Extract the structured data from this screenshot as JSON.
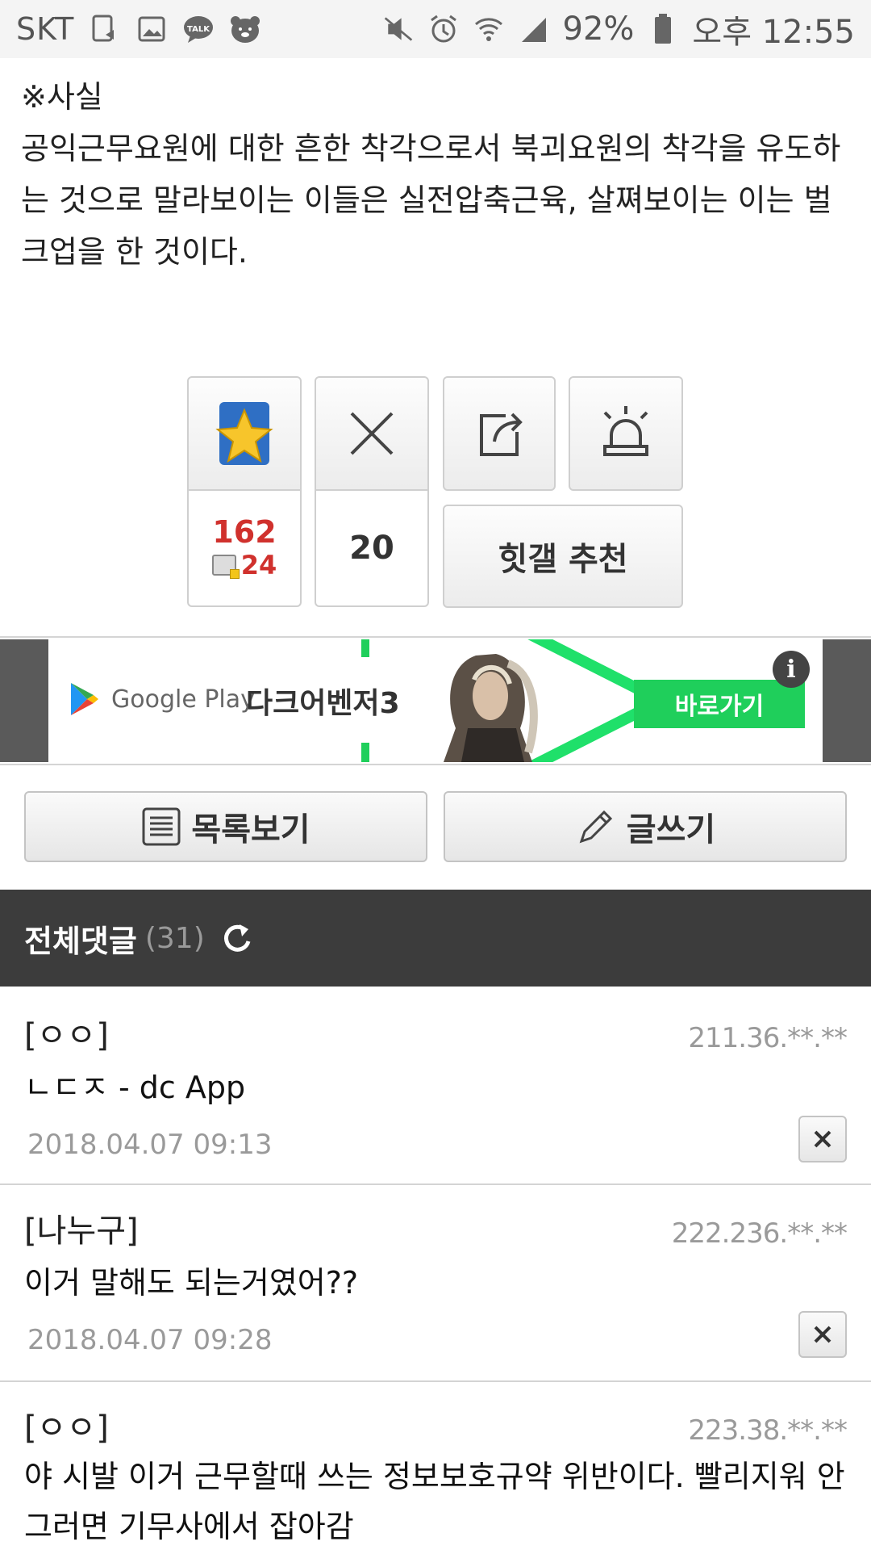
{
  "status_bar": {
    "carrier": "SKT",
    "battery": "92%",
    "time": "오후 12:55",
    "icons": [
      "screen-record-icon",
      "gallery-icon",
      "talk-icon",
      "bear-icon",
      "mute-icon",
      "alarm-icon",
      "wifi-icon",
      "signal-icon",
      "battery-icon"
    ]
  },
  "post": {
    "label": "※사실",
    "body": "공익근무요원에 대한 흔한 착각으로서 북괴요원의 착각을 유도하는 것으로 말라보이는 이들은 실전압축근육, 살쪄보이는 이는 벌크업을 한 것이다."
  },
  "reactions": {
    "recommend_count": "162",
    "fixed_recommend_count": "24",
    "not_recommend_count": "20",
    "hitgal_label": "힛갤 추천",
    "colors": {
      "count_red": "#d0312d"
    }
  },
  "ad": {
    "store": "Google Play",
    "game": "다크어벤저3",
    "cta": "바로가기",
    "info": "i",
    "colors": {
      "accent": "#1fcf5b"
    }
  },
  "actions": {
    "list_label": "목록보기",
    "write_label": "글쓰기"
  },
  "comments_header": {
    "title": "전체댓글",
    "count": "(31)"
  },
  "comments": [
    {
      "name": "[ㅇㅇ]",
      "ip": "211.36.**.**",
      "text": "ㄴㄷㅈ - dc App",
      "date": "2018.04.07 09:13"
    },
    {
      "name": "[나누구]",
      "ip": "222.236.**.**",
      "text": "이거 말해도 되는거였어??",
      "date": "2018.04.07 09:28"
    },
    {
      "name": "[ㅇㅇ]",
      "ip": "223.38.**.**",
      "text": "야 시발 이거 근무할때 쓰는 정보보호규약 위반이다. 빨리지워 안그러면 기무사에서 잡아감",
      "date": ""
    }
  ]
}
